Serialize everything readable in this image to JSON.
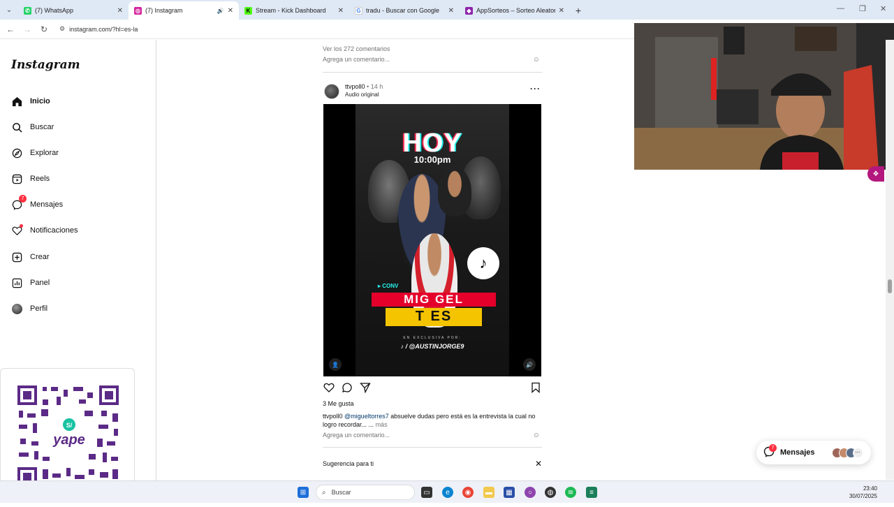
{
  "browser": {
    "tabs": [
      {
        "title": "(7) WhatsApp",
        "favicon_color": "#25d366",
        "active": false
      },
      {
        "title": "(7) Instagram",
        "favicon_color": "#d6249f",
        "active": true
      },
      {
        "title": "Stream - Kick Dashboard",
        "favicon_color": "#53fc18",
        "active": false
      },
      {
        "title": "tradu - Buscar con Google",
        "favicon_color": "#4285f4",
        "active": false
      },
      {
        "title": "AppSorteos – Sorteo Aleatorio",
        "favicon_color": "#8e24aa",
        "active": false
      }
    ],
    "url": "instagram.com/?hl=es-la"
  },
  "instagram": {
    "logo": "Instagram",
    "nav": [
      {
        "label": "Inicio",
        "icon": "home-icon"
      },
      {
        "label": "Buscar",
        "icon": "search-icon"
      },
      {
        "label": "Explorar",
        "icon": "compass-icon"
      },
      {
        "label": "Reels",
        "icon": "reels-icon"
      },
      {
        "label": "Mensajes",
        "icon": "messenger-icon",
        "badge": "7"
      },
      {
        "label": "Notificaciones",
        "icon": "heart-icon"
      },
      {
        "label": "Crear",
        "icon": "plus-square-icon"
      },
      {
        "label": "Panel",
        "icon": "dashboard-icon"
      },
      {
        "label": "Perfil",
        "icon": "avatar-icon"
      }
    ]
  },
  "feed": {
    "prev_comments": "Ver los 272 comentarios",
    "comment_placeholder": "Agrega un comentario...",
    "post": {
      "username": "ttvpoll0",
      "time": "• 14 h",
      "audio": "Audio original",
      "poster": {
        "headline": "HOY",
        "time": "10:00pm",
        "conv": "▸ CONV",
        "name1": "MIG    GEL",
        "name2": "T       ES",
        "exclusive": "EN EXCLUSIVA POR:",
        "handle": "/ @AUSTINJORGE9"
      },
      "likes": "3 Me gusta",
      "caption_user": "ttvpoll0",
      "caption_mention": "@migueltorres7",
      "caption_text": " absuelve dudas pero está es la entrevista la cual no logro recordar... ...",
      "more": "más"
    },
    "suggestion": "Sugerencia para ti"
  },
  "messages_pill": {
    "label": "Mensajes",
    "badge": "7"
  },
  "taskbar": {
    "search": "Buscar",
    "time": "23:40",
    "date": "30/07/2025"
  },
  "colors": {
    "instagram_red": "#ff3040",
    "link": "#00376b"
  }
}
